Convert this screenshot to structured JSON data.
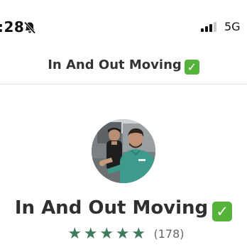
{
  "status_bar": {
    "time": ":28",
    "bell_icon": "bell-slash-icon",
    "signal_icon": "cellular-signal-icon",
    "network": "5G"
  },
  "header": {
    "title": "In And Out Moving",
    "verified_badge": "✓"
  },
  "profile": {
    "avatar_icon": "business-photo",
    "name": "In And Out Moving",
    "verified_badge": "✓",
    "rating": 5,
    "star_glyph": "★",
    "review_count": "(178)",
    "colors": {
      "star": "#3e7a5c",
      "verified": "#55b33b"
    }
  }
}
